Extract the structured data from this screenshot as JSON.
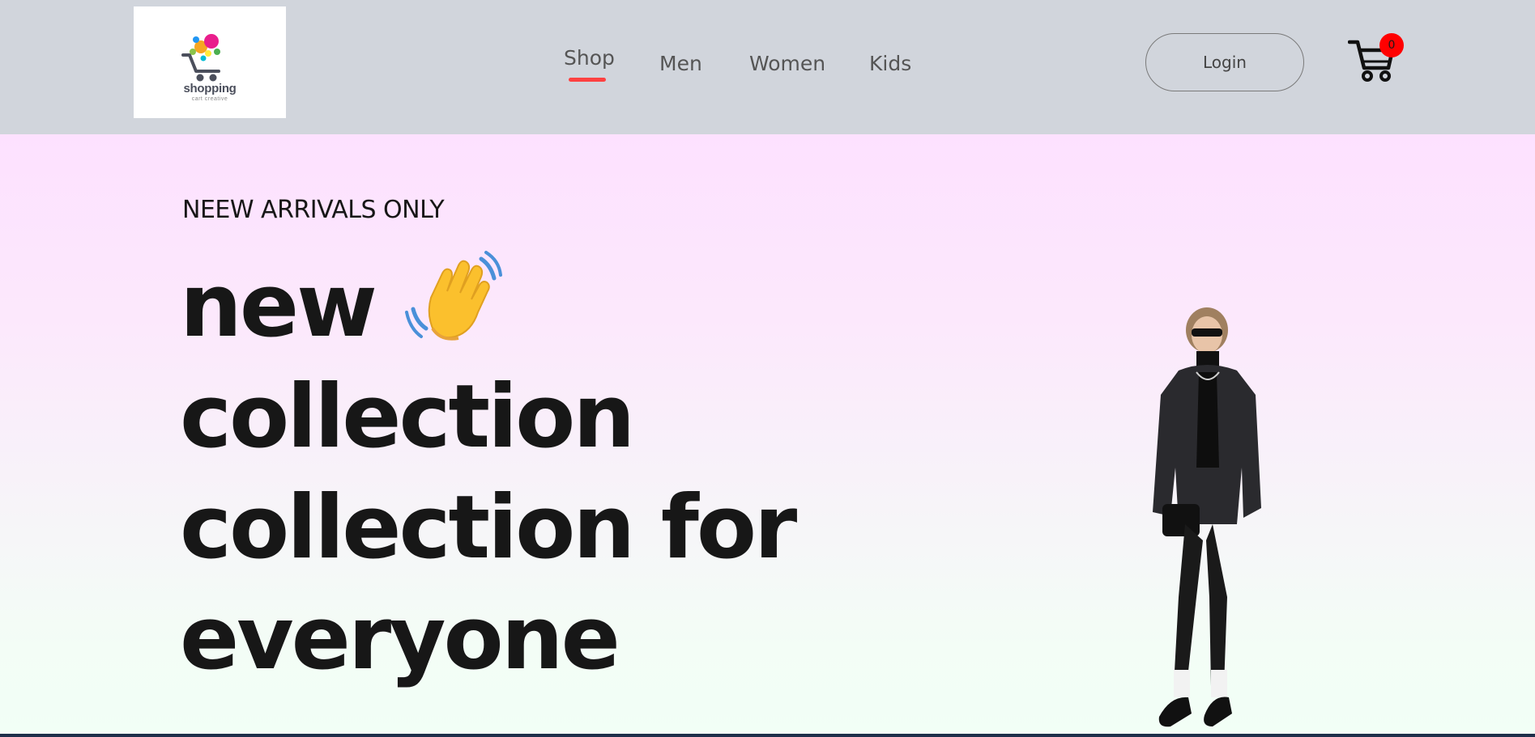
{
  "brand": {
    "logo_text": "shopping",
    "logo_tagline": "cart creative",
    "colors": [
      "#f5a623",
      "#e91e8c",
      "#2196f3",
      "#8bc34a",
      "#ffeb3b"
    ]
  },
  "nav": {
    "items": [
      {
        "label": "Shop",
        "active": true
      },
      {
        "label": "Men",
        "active": false
      },
      {
        "label": "Women",
        "active": false
      },
      {
        "label": "Kids",
        "active": false
      }
    ],
    "active_underline_color": "#ff4141"
  },
  "header_actions": {
    "login_label": "Login",
    "cart_icon": "cart-icon",
    "cart_count": "0",
    "cart_badge_color": "#ff0000"
  },
  "hero": {
    "eyebrow": "NEEW ARRIVALS ONLY",
    "headline_lines": [
      "new",
      "collection",
      "collection for",
      "everyone"
    ],
    "wave_icon": "waving-hand-icon",
    "image": "hero-model-image"
  },
  "colors": {
    "navbar_bg": "#d1d5dc",
    "hero_gradient_top": "#fde1ff",
    "hero_gradient_bottom": "#f2fff6",
    "headline_text": "#171717"
  }
}
